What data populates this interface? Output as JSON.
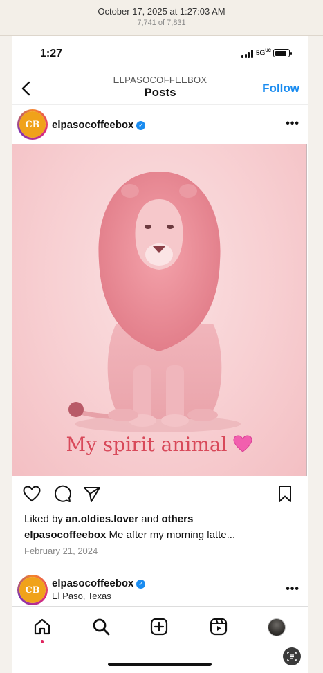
{
  "photos_viewer": {
    "date": "October 17, 2025 at 1:27:03 AM",
    "count": "7,741 of 7,831"
  },
  "status_bar": {
    "time": "1:27",
    "network": "5G",
    "network_sub": "UC",
    "battery_level": 0.9
  },
  "nav": {
    "account": "ELPASOCOFFEEBOX",
    "title": "Posts",
    "follow_label": "Follow"
  },
  "post": {
    "username": "elpasocoffeebox",
    "avatar_logo": "CB",
    "more": "•••",
    "image_caption": "My spirit animal",
    "likes_prefix": "Liked by ",
    "liked_by": "an.oldies.lover",
    "likes_mid": " and ",
    "liked_others": "others",
    "caption_user": "elpasocoffeebox",
    "caption_text": " Me after my morning latte...",
    "date": "February 21, 2024"
  },
  "next_post": {
    "username": "elpasocoffeebox",
    "avatar_logo": "CB",
    "location": "El Paso, Texas",
    "more": "•••"
  },
  "colors": {
    "accent": "#1a8cf0",
    "image_bg": "#f7cdd0",
    "caption_pink": "#d8495a",
    "notification_dot": "#e0245e"
  },
  "icons": {
    "tabs": [
      "home-icon",
      "search-icon",
      "create-icon",
      "reels-icon",
      "profile-icon"
    ],
    "actions": [
      "heart-icon",
      "comment-icon",
      "share-icon",
      "bookmark-icon"
    ]
  }
}
